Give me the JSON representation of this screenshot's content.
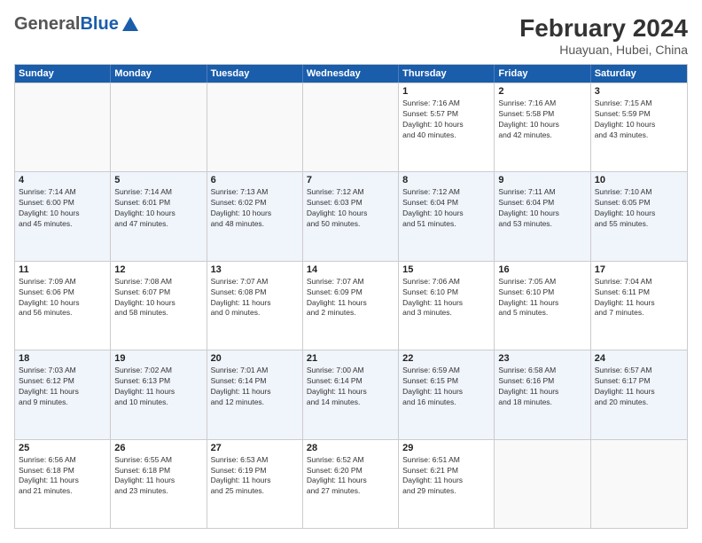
{
  "logo": {
    "general": "General",
    "blue": "Blue"
  },
  "title": {
    "month_year": "February 2024",
    "location": "Huayuan, Hubei, China"
  },
  "weekdays": [
    "Sunday",
    "Monday",
    "Tuesday",
    "Wednesday",
    "Thursday",
    "Friday",
    "Saturday"
  ],
  "rows": [
    [
      {
        "day": "",
        "info": ""
      },
      {
        "day": "",
        "info": ""
      },
      {
        "day": "",
        "info": ""
      },
      {
        "day": "",
        "info": ""
      },
      {
        "day": "1",
        "info": "Sunrise: 7:16 AM\nSunset: 5:57 PM\nDaylight: 10 hours\nand 40 minutes."
      },
      {
        "day": "2",
        "info": "Sunrise: 7:16 AM\nSunset: 5:58 PM\nDaylight: 10 hours\nand 42 minutes."
      },
      {
        "day": "3",
        "info": "Sunrise: 7:15 AM\nSunset: 5:59 PM\nDaylight: 10 hours\nand 43 minutes."
      }
    ],
    [
      {
        "day": "4",
        "info": "Sunrise: 7:14 AM\nSunset: 6:00 PM\nDaylight: 10 hours\nand 45 minutes."
      },
      {
        "day": "5",
        "info": "Sunrise: 7:14 AM\nSunset: 6:01 PM\nDaylight: 10 hours\nand 47 minutes."
      },
      {
        "day": "6",
        "info": "Sunrise: 7:13 AM\nSunset: 6:02 PM\nDaylight: 10 hours\nand 48 minutes."
      },
      {
        "day": "7",
        "info": "Sunrise: 7:12 AM\nSunset: 6:03 PM\nDaylight: 10 hours\nand 50 minutes."
      },
      {
        "day": "8",
        "info": "Sunrise: 7:12 AM\nSunset: 6:04 PM\nDaylight: 10 hours\nand 51 minutes."
      },
      {
        "day": "9",
        "info": "Sunrise: 7:11 AM\nSunset: 6:04 PM\nDaylight: 10 hours\nand 53 minutes."
      },
      {
        "day": "10",
        "info": "Sunrise: 7:10 AM\nSunset: 6:05 PM\nDaylight: 10 hours\nand 55 minutes."
      }
    ],
    [
      {
        "day": "11",
        "info": "Sunrise: 7:09 AM\nSunset: 6:06 PM\nDaylight: 10 hours\nand 56 minutes."
      },
      {
        "day": "12",
        "info": "Sunrise: 7:08 AM\nSunset: 6:07 PM\nDaylight: 10 hours\nand 58 minutes."
      },
      {
        "day": "13",
        "info": "Sunrise: 7:07 AM\nSunset: 6:08 PM\nDaylight: 11 hours\nand 0 minutes."
      },
      {
        "day": "14",
        "info": "Sunrise: 7:07 AM\nSunset: 6:09 PM\nDaylight: 11 hours\nand 2 minutes."
      },
      {
        "day": "15",
        "info": "Sunrise: 7:06 AM\nSunset: 6:10 PM\nDaylight: 11 hours\nand 3 minutes."
      },
      {
        "day": "16",
        "info": "Sunrise: 7:05 AM\nSunset: 6:10 PM\nDaylight: 11 hours\nand 5 minutes."
      },
      {
        "day": "17",
        "info": "Sunrise: 7:04 AM\nSunset: 6:11 PM\nDaylight: 11 hours\nand 7 minutes."
      }
    ],
    [
      {
        "day": "18",
        "info": "Sunrise: 7:03 AM\nSunset: 6:12 PM\nDaylight: 11 hours\nand 9 minutes."
      },
      {
        "day": "19",
        "info": "Sunrise: 7:02 AM\nSunset: 6:13 PM\nDaylight: 11 hours\nand 10 minutes."
      },
      {
        "day": "20",
        "info": "Sunrise: 7:01 AM\nSunset: 6:14 PM\nDaylight: 11 hours\nand 12 minutes."
      },
      {
        "day": "21",
        "info": "Sunrise: 7:00 AM\nSunset: 6:14 PM\nDaylight: 11 hours\nand 14 minutes."
      },
      {
        "day": "22",
        "info": "Sunrise: 6:59 AM\nSunset: 6:15 PM\nDaylight: 11 hours\nand 16 minutes."
      },
      {
        "day": "23",
        "info": "Sunrise: 6:58 AM\nSunset: 6:16 PM\nDaylight: 11 hours\nand 18 minutes."
      },
      {
        "day": "24",
        "info": "Sunrise: 6:57 AM\nSunset: 6:17 PM\nDaylight: 11 hours\nand 20 minutes."
      }
    ],
    [
      {
        "day": "25",
        "info": "Sunrise: 6:56 AM\nSunset: 6:18 PM\nDaylight: 11 hours\nand 21 minutes."
      },
      {
        "day": "26",
        "info": "Sunrise: 6:55 AM\nSunset: 6:18 PM\nDaylight: 11 hours\nand 23 minutes."
      },
      {
        "day": "27",
        "info": "Sunrise: 6:53 AM\nSunset: 6:19 PM\nDaylight: 11 hours\nand 25 minutes."
      },
      {
        "day": "28",
        "info": "Sunrise: 6:52 AM\nSunset: 6:20 PM\nDaylight: 11 hours\nand 27 minutes."
      },
      {
        "day": "29",
        "info": "Sunrise: 6:51 AM\nSunset: 6:21 PM\nDaylight: 11 hours\nand 29 minutes."
      },
      {
        "day": "",
        "info": ""
      },
      {
        "day": "",
        "info": ""
      }
    ]
  ]
}
